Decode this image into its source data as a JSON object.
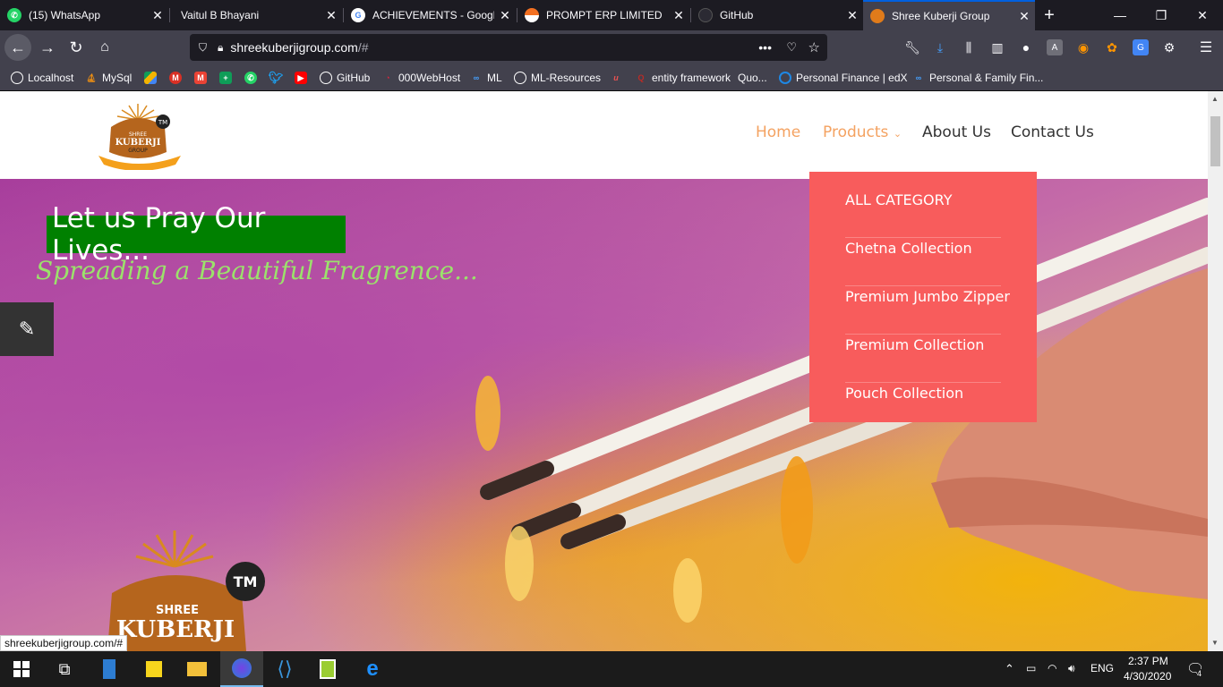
{
  "browser": {
    "tabs": [
      {
        "label": "(15) WhatsApp",
        "icon": "whatsapp-icon"
      },
      {
        "label": "Vaitul B Bhayani",
        "icon": "none"
      },
      {
        "label": "ACHIEVEMENTS - Googl",
        "icon": "google-icon"
      },
      {
        "label": "PROMPT ERP LIMITED",
        "icon": "prompt-icon"
      },
      {
        "label": "GitHub",
        "icon": "github-icon"
      },
      {
        "label": "Shree Kuberji Group",
        "icon": "kuberji-icon"
      }
    ],
    "url_host": "shreekuberjigroup.com",
    "url_rest": "/#",
    "bookmarks": [
      {
        "label": "Localhost",
        "icon": "globe-icon"
      },
      {
        "label": "MySql",
        "icon": "mysql-icon"
      },
      {
        "label": "",
        "icon": "drive-icon"
      },
      {
        "label": "",
        "icon": "gmail-icon"
      },
      {
        "label": "",
        "icon": "gmail-icon"
      },
      {
        "label": "",
        "icon": "sheets-icon"
      },
      {
        "label": "",
        "icon": "whatsapp-icon"
      },
      {
        "label": "",
        "icon": "twitter-icon"
      },
      {
        "label": "",
        "icon": "youtube-icon"
      },
      {
        "label": "GitHub",
        "icon": "github-icon"
      },
      {
        "label": "000WebHost",
        "icon": "webhost-icon"
      },
      {
        "label": "ML",
        "icon": "link-icon"
      },
      {
        "label": "ML-Resources",
        "icon": "globe-icon"
      },
      {
        "label": "",
        "icon": "udemy-icon"
      },
      {
        "label": "entity framework",
        "icon": "quora-icon"
      },
      {
        "label": "Quo...",
        "icon": "none"
      },
      {
        "label": "Personal Finance | edX",
        "icon": "edx-icon"
      },
      {
        "label": "Personal & Family Fin...",
        "icon": "link-icon"
      }
    ]
  },
  "site": {
    "menu": {
      "home": "Home",
      "products": "Products",
      "about": "About Us",
      "contact": "Contact Us"
    },
    "logo": {
      "top": "SHREE",
      "main": "KUBERJI",
      "bottom": "GROUP",
      "tm": "TM"
    },
    "hero_title": "Let us Pray Our Lives...",
    "hero_subtitle": "Spreading a Beautiful Fragrence...",
    "dropdown": [
      "ALL CATEGORY",
      "Chetna Collection",
      "Premium Jumbo Zipper",
      "Premium Collection",
      "Pouch Collection"
    ],
    "status_url": "shreekuberjigroup.com/#"
  },
  "taskbar": {
    "lang": "ENG",
    "time": "2:37 PM",
    "date": "4/30/2020",
    "notifications": "4"
  },
  "colors": {
    "active_menu": "#f4a261",
    "dropdown_bg": "#f85c5c",
    "hero_title_bg": "#008000",
    "hero_subtitle": "#9be26b"
  }
}
